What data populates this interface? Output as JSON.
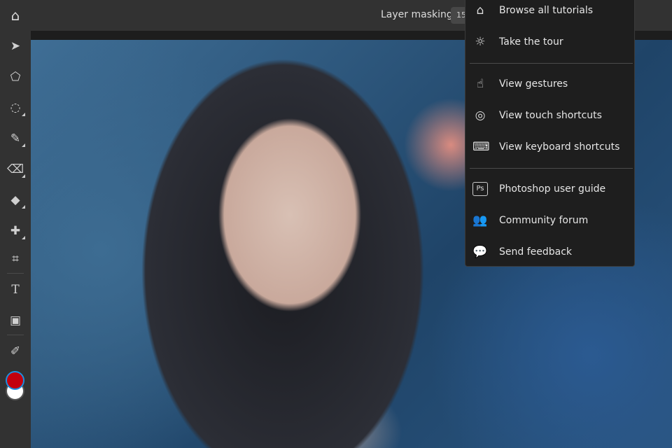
{
  "header": {
    "title": "Layer masking",
    "zoom": "15"
  },
  "menu": {
    "items": [
      {
        "label": "Browse all tutorials",
        "icon": "home-icon"
      },
      {
        "label": "Take the tour",
        "icon": "lightbulb-icon"
      },
      {
        "label": "View gestures",
        "icon": "gesture-icon"
      },
      {
        "label": "View touch shortcuts",
        "icon": "touch-shortcut-icon"
      },
      {
        "label": "View keyboard shortcuts",
        "icon": "keyboard-icon"
      },
      {
        "label": "Photoshop user guide",
        "icon": "ps-icon"
      },
      {
        "label": "Community forum",
        "icon": "people-icon"
      },
      {
        "label": "Send feedback",
        "icon": "feedback-icon"
      }
    ]
  },
  "colors": {
    "foreground": "#c3000e",
    "background": "#ffffff"
  }
}
